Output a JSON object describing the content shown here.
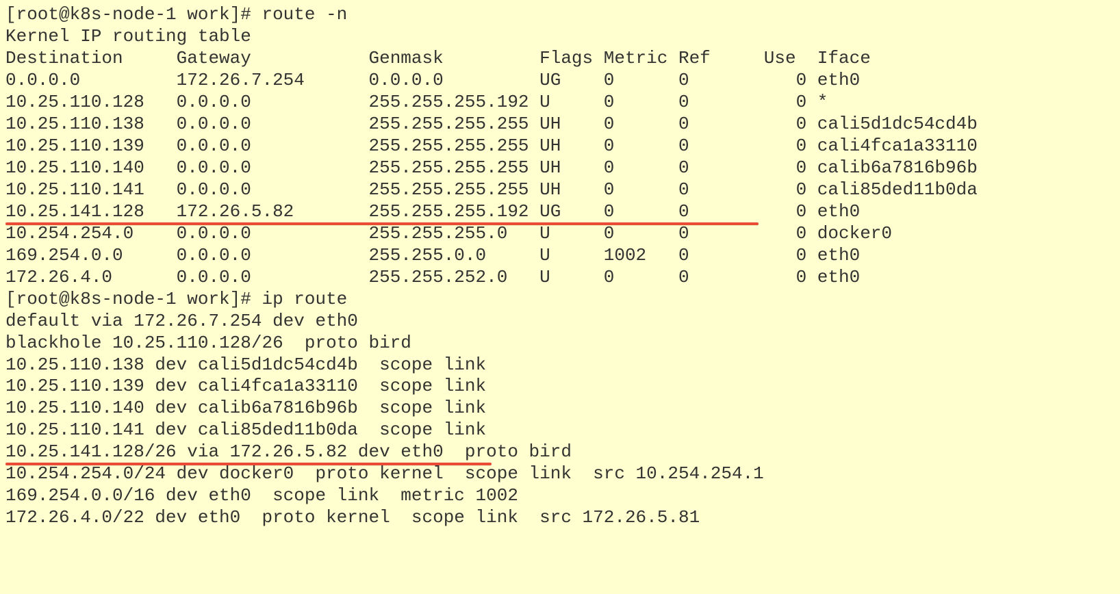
{
  "prompt": "[root@k8s-node-1 work]# ",
  "cmd_route": "route -n",
  "cmd_iproute": "ip route",
  "route_n": {
    "title": "Kernel IP routing table",
    "headers": {
      "dest": "Destination",
      "gw": "Gateway",
      "mask": "Genmask",
      "flags": "Flags",
      "metric": "Metric",
      "ref": "Ref",
      "use": "Use",
      "iface": "Iface"
    },
    "rows": [
      {
        "dest": "0.0.0.0",
        "gw": "172.26.7.254",
        "mask": "0.0.0.0",
        "flags": "UG",
        "metric": "0",
        "ref": "0",
        "use": "0",
        "iface": "eth0"
      },
      {
        "dest": "10.25.110.128",
        "gw": "0.0.0.0",
        "mask": "255.255.255.192",
        "flags": "U",
        "metric": "0",
        "ref": "0",
        "use": "0",
        "iface": "*"
      },
      {
        "dest": "10.25.110.138",
        "gw": "0.0.0.0",
        "mask": "255.255.255.255",
        "flags": "UH",
        "metric": "0",
        "ref": "0",
        "use": "0",
        "iface": "cali5d1dc54cd4b"
      },
      {
        "dest": "10.25.110.139",
        "gw": "0.0.0.0",
        "mask": "255.255.255.255",
        "flags": "UH",
        "metric": "0",
        "ref": "0",
        "use": "0",
        "iface": "cali4fca1a33110"
      },
      {
        "dest": "10.25.110.140",
        "gw": "0.0.0.0",
        "mask": "255.255.255.255",
        "flags": "UH",
        "metric": "0",
        "ref": "0",
        "use": "0",
        "iface": "calib6a7816b96b"
      },
      {
        "dest": "10.25.110.141",
        "gw": "0.0.0.0",
        "mask": "255.255.255.255",
        "flags": "UH",
        "metric": "0",
        "ref": "0",
        "use": "0",
        "iface": "cali85ded11b0da"
      },
      {
        "dest": "10.25.141.128",
        "gw": "172.26.5.82",
        "mask": "255.255.255.192",
        "flags": "UG",
        "metric": "0",
        "ref": "0",
        "use": "0",
        "iface": "eth0"
      },
      {
        "dest": "10.254.254.0",
        "gw": "0.0.0.0",
        "mask": "255.255.255.0",
        "flags": "U",
        "metric": "0",
        "ref": "0",
        "use": "0",
        "iface": "docker0"
      },
      {
        "dest": "169.254.0.0",
        "gw": "0.0.0.0",
        "mask": "255.255.0.0",
        "flags": "U",
        "metric": "1002",
        "ref": "0",
        "use": "0",
        "iface": "eth0"
      },
      {
        "dest": "172.26.4.0",
        "gw": "0.0.0.0",
        "mask": "255.255.252.0",
        "flags": "U",
        "metric": "0",
        "ref": "0",
        "use": "0",
        "iface": "eth0"
      }
    ]
  },
  "ip_route": {
    "lines": [
      "default via 172.26.7.254 dev eth0 ",
      "blackhole 10.25.110.128/26  proto bird ",
      "10.25.110.138 dev cali5d1dc54cd4b  scope link ",
      "10.25.110.139 dev cali4fca1a33110  scope link ",
      "10.25.110.140 dev calib6a7816b96b  scope link ",
      "10.25.110.141 dev cali85ded11b0da  scope link ",
      "10.25.141.128/26 via 172.26.5.82 dev eth0  proto bird ",
      "10.254.254.0/24 dev docker0  proto kernel  scope link  src 10.254.254.1 ",
      "169.254.0.0/16 dev eth0  scope link  metric 1002 ",
      "172.26.4.0/22 dev eth0  proto kernel  scope link  src 172.26.5.81 "
    ]
  },
  "col_widths": {
    "dest": 16,
    "gw": 18,
    "mask": 16,
    "flags": 6,
    "metric": 7,
    "ref": 8,
    "use": 4,
    "iface": 0
  },
  "underlines": {
    "route_row_index": 6,
    "iproute_line_index": 6
  }
}
